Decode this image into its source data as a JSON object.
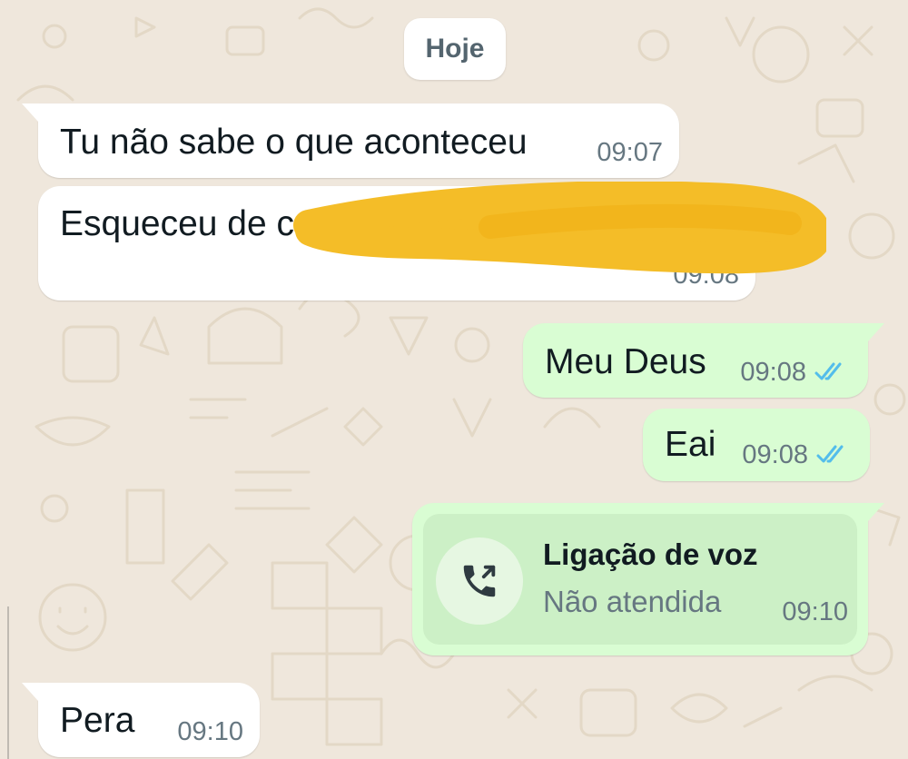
{
  "date_separator": "Hoje",
  "messages": [
    {
      "direction": "incoming",
      "text": "Tu não sabe o que aconteceu",
      "time": "09:07"
    },
    {
      "direction": "incoming",
      "text": "Esqueceu de c",
      "time": "09:08",
      "redacted": true
    },
    {
      "direction": "outgoing",
      "text": "Meu Deus",
      "time": "09:08",
      "status": "read"
    },
    {
      "direction": "outgoing",
      "text": "Eai",
      "time": "09:08",
      "status": "read"
    },
    {
      "direction": "outgoing",
      "type": "call",
      "title": "Ligação de voz",
      "subtitle": "Não atendida",
      "time": "09:10",
      "icon": "phone-call-icon"
    },
    {
      "direction": "incoming",
      "text": "Pera",
      "time": "09:10"
    }
  ],
  "colors": {
    "wallpaper": "#efe7dc",
    "incoming_bubble": "#ffffff",
    "outgoing_bubble": "#d9fdd3",
    "call_card": "#ccf0c6",
    "read_ticks": "#53bdeb",
    "scribble": "#f4bd28",
    "timestamp": "#667781"
  }
}
